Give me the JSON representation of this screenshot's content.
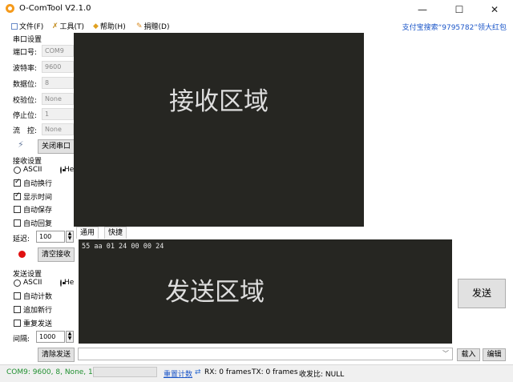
{
  "window": {
    "title": "O-ComTool V2.1.0",
    "minimize_glyph": "—",
    "maximize_glyph": "☐",
    "close_glyph": "✕"
  },
  "menu": {
    "file": "文件(F)",
    "tools": "工具(T)",
    "help": "帮助(H)",
    "donate": "捐赠(D)",
    "promo": "支付宝搜索“9795782”领大红包"
  },
  "serial": {
    "group_title": "串口设置",
    "port_label": "端口号:",
    "port_value": "COM9",
    "baud_label": "波特率:",
    "baud_value": "9600",
    "data_label": "数据位:",
    "data_value": "8",
    "parity_label": "校验位:",
    "parity_value": "None",
    "stop_label": "停止位:",
    "stop_value": "1",
    "flow_label": "流　控:",
    "flow_value": "None",
    "close_button": "关闭串口"
  },
  "receive": {
    "group_title": "接收设置",
    "ascii": "ASCII",
    "hex": "Hex",
    "auto_newline": "自动换行",
    "show_time": "显示时间",
    "auto_save": "自动保存",
    "auto_reply": "自动回复",
    "delay_label": "延迟:",
    "delay_value": "100",
    "clear_button": "清空接收",
    "area_label": "接收区域"
  },
  "send": {
    "group_title": "发送设置",
    "ascii": "ASCII",
    "hex": "Hex",
    "auto_count": "自动计数",
    "append_newline": "追加新行",
    "repeat_send": "重复发送",
    "interval_label": "间隔:",
    "interval_value": "1000",
    "clear_button": "清除发送",
    "tab_general": "通用",
    "tab_quick": "快捷",
    "content": "55 aa 01 24 00 00 24",
    "area_label": "发送区域",
    "send_button": "发送",
    "load_button": "载入",
    "edit_button": "编辑"
  },
  "status": {
    "port_info": "COM9: 9600, 8, None, 1",
    "reset_count": "重置计数",
    "rx": "RX: 0 frames",
    "tx": "TX: 0 frames",
    "ratio": "收发比: NULL"
  },
  "colors": {
    "console_bg": "#262622",
    "status_green": "#1f8f2f",
    "link_blue": "#1a55c8",
    "record_red": "#e01010"
  }
}
